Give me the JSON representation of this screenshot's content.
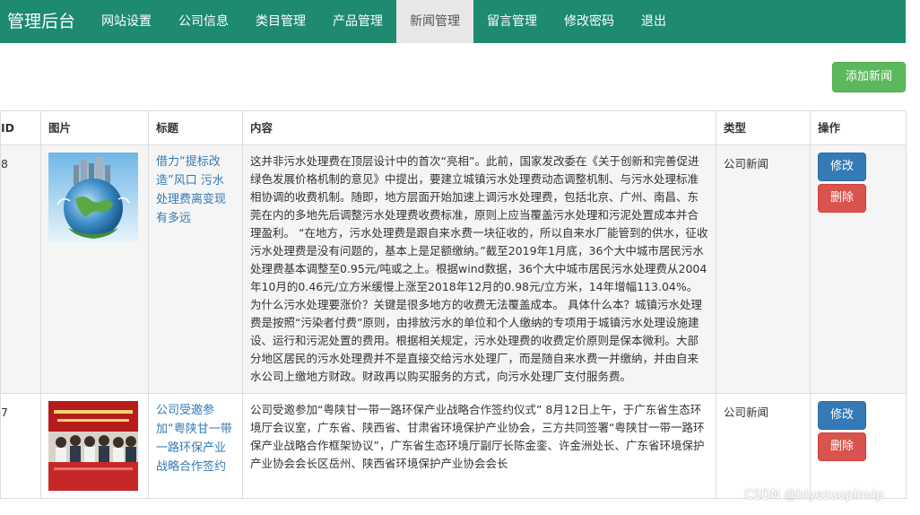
{
  "navbar": {
    "brand": "管理后台",
    "items": [
      {
        "label": "网站设置"
      },
      {
        "label": "公司信息"
      },
      {
        "label": "类目管理"
      },
      {
        "label": "产品管理"
      },
      {
        "label": "新闻管理"
      },
      {
        "label": "留言管理"
      },
      {
        "label": "修改密码"
      },
      {
        "label": "退出"
      }
    ],
    "active": "新闻管理"
  },
  "toolbar": {
    "add_label": "添加新闻"
  },
  "table": {
    "headers": {
      "id": "ID",
      "image": "图片",
      "title": "标题",
      "content": "内容",
      "type": "类型",
      "actions": "操作"
    },
    "edit_label": "修改",
    "delete_label": "删除",
    "rows": [
      {
        "id": "8",
        "title": "借力“提标改造”风口 污水处理费离变现有多远",
        "content": "这并非污水处理费在顶层设计中的首次“亮相”。此前，国家发改委在《关于创新和完善促进绿色发展价格机制的意见》中提出，要建立城镇污水处理费动态调整机制、与污水处理标准相协调的收费机制。随即，地方层面开始加速上调污水处理费，包括北京、广州、南昌、东莞在内的多地先后调整污水处理费收费标准，原则上应当覆盖污水处理和污泥处置成本并合理盈利。          “在地方，污水处理费是跟自来水费一块征收的，所以自来水厂能管到的供水，征收污水处理费是没有问题的，基本上是足额缴纳。”截至2019年1月底，36个大中城市居民污水处理费基本调整至0.95元/吨或之上。根据wind数据，36个大中城市居民污水处理费从2004年10月的0.46元/立方米缓慢上涨至2018年12月的0.98元/立方米，14年增幅113.04%。为什么污水处理要涨价？关键是很多地方的收费无法覆盖成本。          具体什么本？城镇污水处理费是按照“污染者付费”原则，由排放污水的单位和个人缴纳的专项用于城镇污水处理设施建设、运行和污泥处置的费用。根据相关规定，污水处理费的收费定价原则是保本微利。大部分地区居民的污水处理费并不是直接交给污水处理厂，而是随自来水费一并缴纳，并由自来水公司上缴地方财政。财政再以购买服务的方式，向污水处理厂支付服务费。",
        "type": "公司新闻"
      },
      {
        "id": "7",
        "title": "公司受邀参加“粤陕甘一带一路环保产业战略合作签约",
        "content": "公司受邀参加“粤陕甘一带一路环保产业战略合作签约仪式” 8月12日上午，于广东省生态环境厅会议室，广东省、陕西省、甘肃省环境保护产业协会，三方共同签署“粤陕甘一带一路环保产业战略合作框架协议”，广东省生态环境厅副厅长陈金銮、许金洲处长、广东省环境保护产业协会会长区岳州、陕西省环境保护产业协会会长",
        "type": "公司新闻"
      }
    ]
  },
  "watermark": "CSDN @biyezuopinvip"
}
